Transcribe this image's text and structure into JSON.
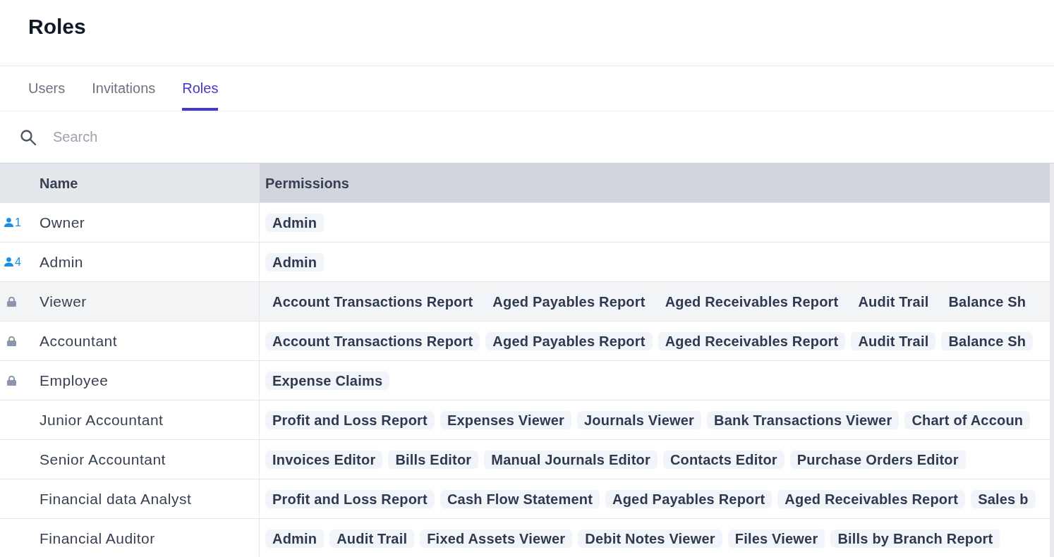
{
  "page": {
    "title": "Roles"
  },
  "tabs": [
    {
      "label": "Users",
      "selected": false
    },
    {
      "label": "Invitations",
      "selected": false
    },
    {
      "label": "Roles",
      "selected": true
    }
  ],
  "search": {
    "placeholder": "Search"
  },
  "table": {
    "columns": [
      {
        "label": "Name",
        "highlighted": false
      },
      {
        "label": "Permissions",
        "highlighted": true
      }
    ],
    "rows": [
      {
        "marker": {
          "kind": "users",
          "count": "1"
        },
        "name": "Owner",
        "highlighted": false,
        "permissions": [
          "Admin"
        ]
      },
      {
        "marker": {
          "kind": "users",
          "count": "4"
        },
        "name": "Admin",
        "highlighted": false,
        "permissions": [
          "Admin"
        ]
      },
      {
        "marker": {
          "kind": "locked"
        },
        "name": "Viewer",
        "highlighted": true,
        "permissions": [
          "Account Transactions Report",
          "Aged Payables Report",
          "Aged Receivables Report",
          "Audit Trail",
          "Balance Sh"
        ]
      },
      {
        "marker": {
          "kind": "locked"
        },
        "name": "Accountant",
        "highlighted": false,
        "permissions": [
          "Account Transactions Report",
          "Aged Payables Report",
          "Aged Receivables Report",
          "Audit Trail",
          "Balance Sh"
        ]
      },
      {
        "marker": {
          "kind": "locked"
        },
        "name": "Employee",
        "highlighted": false,
        "permissions": [
          "Expense Claims"
        ]
      },
      {
        "name": "Junior Accountant",
        "highlighted": false,
        "permissions": [
          "Profit and Loss Report",
          "Expenses Viewer",
          "Journals Viewer",
          "Bank Transactions Viewer",
          "Chart of Accoun"
        ]
      },
      {
        "name": "Senior Accountant",
        "highlighted": false,
        "permissions": [
          "Invoices Editor",
          "Bills Editor",
          "Manual Journals Editor",
          "Contacts Editor",
          "Purchase Orders Editor"
        ]
      },
      {
        "name": "Financial data Analyst",
        "highlighted": false,
        "permissions": [
          "Profit and Loss Report",
          "Cash Flow Statement",
          "Aged Payables Report",
          "Aged Receivables Report",
          "Sales b"
        ]
      },
      {
        "name": "Financial Auditor",
        "highlighted": false,
        "permissions": [
          "Admin",
          "Audit Trail",
          "Fixed Assets Viewer",
          "Debit Notes Viewer",
          "Files Viewer",
          "Bills by Branch Report"
        ]
      }
    ]
  }
}
